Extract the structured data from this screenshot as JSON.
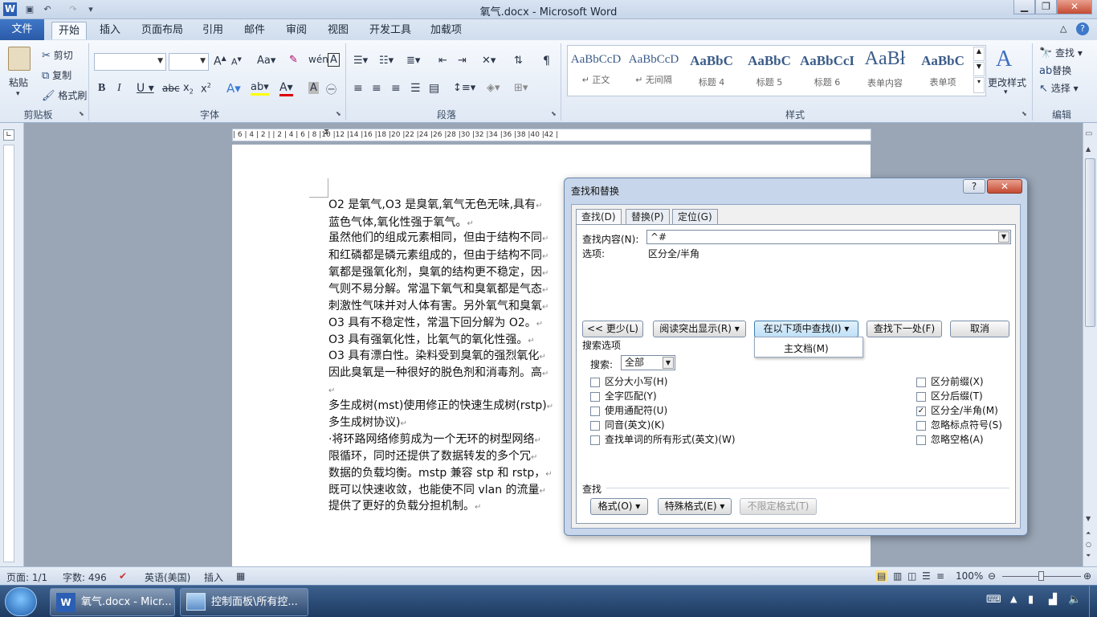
{
  "window": {
    "title": "氧气.docx - Microsoft Word",
    "word_logo": "W"
  },
  "tabs": {
    "file": "文件",
    "items": [
      "开始",
      "插入",
      "页面布局",
      "引用",
      "邮件",
      "审阅",
      "视图",
      "开发工具",
      "加载项"
    ]
  },
  "ribbon": {
    "clipboard": {
      "paste": "粘贴",
      "cut": "剪切",
      "copy": "复制",
      "format_painter": "格式刷",
      "label": "剪贴板"
    },
    "font": {
      "label": "字体"
    },
    "paragraph": {
      "label": "段落"
    },
    "styles": {
      "label": "样式",
      "items": [
        {
          "preview": "AaBbCcD",
          "name": "↵ 正文"
        },
        {
          "preview": "AaBbCcD",
          "name": "↵ 无间隔"
        },
        {
          "preview": "AaBbC",
          "name": "标题 4"
        },
        {
          "preview": "AaBbC",
          "name": "标题 5"
        },
        {
          "preview": "AaBbCcI",
          "name": "标题 6"
        },
        {
          "preview": "AaBł",
          "name": "表单内容"
        },
        {
          "preview": "AaBbC",
          "name": "表单项"
        }
      ],
      "change_styles": "更改样式"
    },
    "editing": {
      "find": "查找",
      "replace": "替换",
      "select": "选择",
      "label": "编辑"
    }
  },
  "ruler": {
    "ticks": "| 6 | 4 | 2 |   | 2 | 4 | 6 | 8 |10 |12 |14 |16 |18 |20 |22 |24 |26 |28 |30 |32 |34 |36 |38 |40 |42 |"
  },
  "document": {
    "lines": [
      "O2 是氧气,O3 是臭氧,氧气无色无味,具有",
      "蓝色气体,氧化性强于氧气。",
      "虽然他们的组成元素相同，但由于结构不同",
      "和红磷都是磷元素组成的，但由于结构不同",
      "氧都是强氧化剂，臭氧的结构更不稳定，因",
      "气则不易分解。常温下氧气和臭氧都是气态",
      "刺激性气味并对人体有害。另外氧气和臭氧",
      "O3 具有不稳定性，常温下回分解为 O2。",
      "O3 具有强氧化性，比氧气的氧化性强。",
      "O3 具有漂白性。染料受到臭氧的强烈氧化",
      "因此臭氧是一种很好的脱色剂和消毒剂。高",
      "",
      "多生成树(mst)使用修正的快速生成树(rstp)",
      "多生成树协议)",
      "·将环路网络修剪成为一个无环的树型网络",
      "限循环，同时还提供了数据转发的多个冗",
      "数据的负载均衡。mstp 兼容 stp 和 rstp，",
      "既可以快速收敛，也能使不同 vlan 的流量",
      "提供了更好的负载分担机制。"
    ]
  },
  "dialog": {
    "title": "查找和替换",
    "help": "?",
    "close": "✕",
    "tabs": [
      "查找(D)",
      "替换(P)",
      "定位(G)"
    ],
    "find_label": "查找内容(N):",
    "find_value": "^#",
    "options_label": "选项:",
    "options_value": "区分全/半角",
    "buttons": {
      "less": "<< 更少(L)",
      "reading_highlight": "阅读突出显示(R) ▾",
      "find_in": "在以下项中查找(I) ▾",
      "find_next": "查找下一处(F)",
      "cancel": "取消"
    },
    "find_in_menu": [
      "主文档(M)"
    ],
    "search_options_title": "搜索选项",
    "search_label": "搜索:",
    "search_value": "全部",
    "left_options": [
      {
        "label": "区分大小写(H)",
        "checked": false
      },
      {
        "label": "全字匹配(Y)",
        "checked": false
      },
      {
        "label": "使用通配符(U)",
        "checked": false
      },
      {
        "label": "同音(英文)(K)",
        "checked": false
      },
      {
        "label": "查找单词的所有形式(英文)(W)",
        "checked": false
      }
    ],
    "right_options": [
      {
        "label": "区分前缀(X)",
        "checked": false
      },
      {
        "label": "区分后缀(T)",
        "checked": false
      },
      {
        "label": "区分全/半角(M)",
        "checked": true
      },
      {
        "label": "忽略标点符号(S)",
        "checked": false
      },
      {
        "label": "忽略空格(A)",
        "checked": false
      }
    ],
    "find_section": "查找",
    "format_btn": "格式(O) ▾",
    "special_btn": "特殊格式(E) ▾",
    "no_format_btn": "不限定格式(T)"
  },
  "status": {
    "page": "页面: 1/1",
    "words": "字数: 496",
    "language": "英语(美国)",
    "insert": "插入",
    "zoom": "100%"
  },
  "taskbar": {
    "items": [
      "氧气.docx - Micr...",
      "控制面板\\所有控..."
    ]
  }
}
